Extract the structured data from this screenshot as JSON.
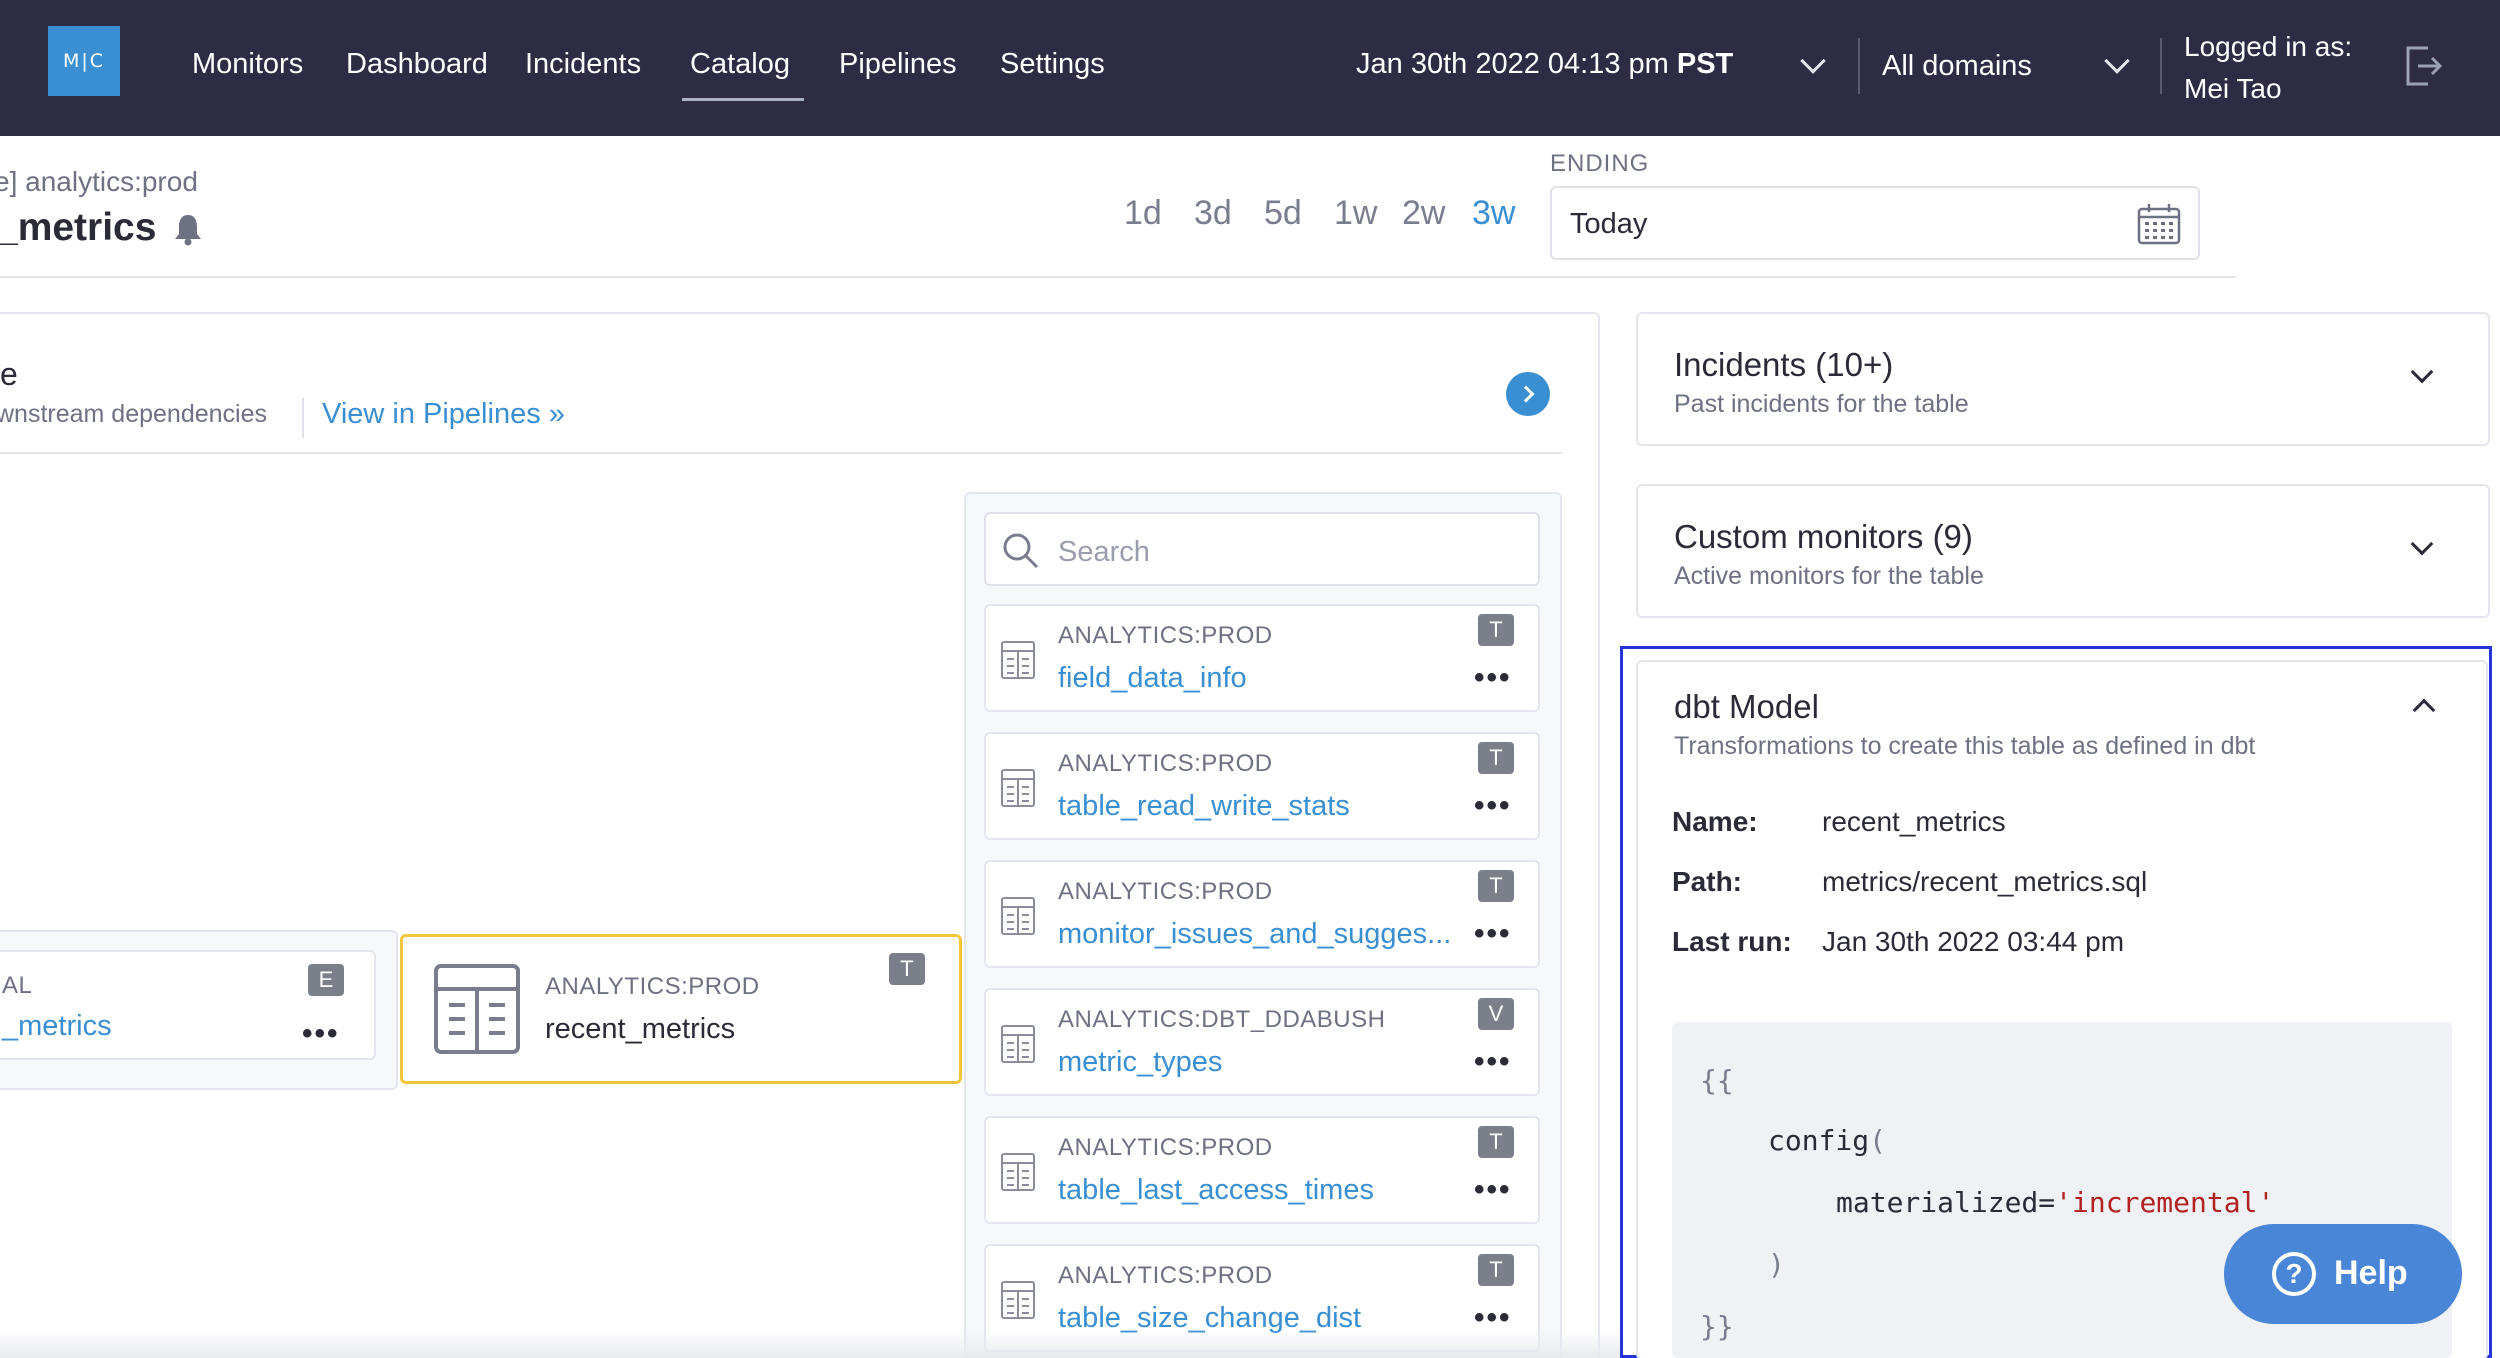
{
  "brand": {
    "logo_text": "M|C"
  },
  "nav": {
    "items": [
      "Monitors",
      "Dashboard",
      "Incidents",
      "Catalog",
      "Pipelines",
      "Settings"
    ],
    "active": "Catalog",
    "datetime": "Jan 30th 2022 04:13 pm",
    "timezone": "PST",
    "domain_select": "All domains",
    "logged_in_label": "Logged in as:",
    "user_name": "Mei Tao"
  },
  "header": {
    "breadcrumb": "e] analytics:prod",
    "table_title": "_metrics",
    "ranges": [
      "1d",
      "3d",
      "5d",
      "1w",
      "2w",
      "3w"
    ],
    "active_range": "3w",
    "ending_label": "ENDING",
    "ending_value": "Today"
  },
  "lineage": {
    "title": "e",
    "subtitle": "wnstream dependencies",
    "view_link": "View in Pipelines »",
    "upstream": {
      "schema": "AL",
      "name": "_metrics",
      "badge": "E"
    },
    "selected": {
      "schema": "ANALYTICS:PROD",
      "name": "recent_metrics",
      "badge": "T"
    },
    "search_placeholder": "Search",
    "downstream": [
      {
        "schema": "ANALYTICS:PROD",
        "name": "field_data_info",
        "badge": "T"
      },
      {
        "schema": "ANALYTICS:PROD",
        "name": "table_read_write_stats",
        "badge": "T"
      },
      {
        "schema": "ANALYTICS:PROD",
        "name": "monitor_issues_and_sugges...",
        "badge": "T"
      },
      {
        "schema": "ANALYTICS:DBT_DDABUSH",
        "name": "metric_types",
        "badge": "V"
      },
      {
        "schema": "ANALYTICS:PROD",
        "name": "table_last_access_times",
        "badge": "T"
      },
      {
        "schema": "ANALYTICS:PROD",
        "name": "table_size_change_dist",
        "badge": "T"
      }
    ],
    "more_dots": "•••"
  },
  "cards": {
    "incidents": {
      "title": "Incidents (10+)",
      "subtitle": "Past incidents for the table"
    },
    "monitors": {
      "title": "Custom monitors (9)",
      "subtitle": "Active monitors for the table"
    },
    "dbt": {
      "title": "dbt Model",
      "subtitle": "Transformations to create this table as defined in dbt",
      "name_label": "Name:",
      "name_value": "recent_metrics",
      "path_label": "Path:",
      "path_value": "metrics/recent_metrics.sql",
      "last_run_label": "Last run:",
      "last_run_value": "Jan 30th 2022 03:44 pm",
      "code": {
        "line1": "{{",
        "line2_fn": "config",
        "line2_paren": "(",
        "line3_key": "materialized=",
        "line3_val": "'incremental'",
        "line4": ")",
        "line5": "}}"
      }
    }
  },
  "help": {
    "label": "Help",
    "icon_glyph": "?"
  },
  "colors": {
    "nav_bg": "#2e2c45",
    "accent": "#3a8fd2",
    "highlight_border": "#2437d6",
    "selected_node": "#f2c63c"
  }
}
